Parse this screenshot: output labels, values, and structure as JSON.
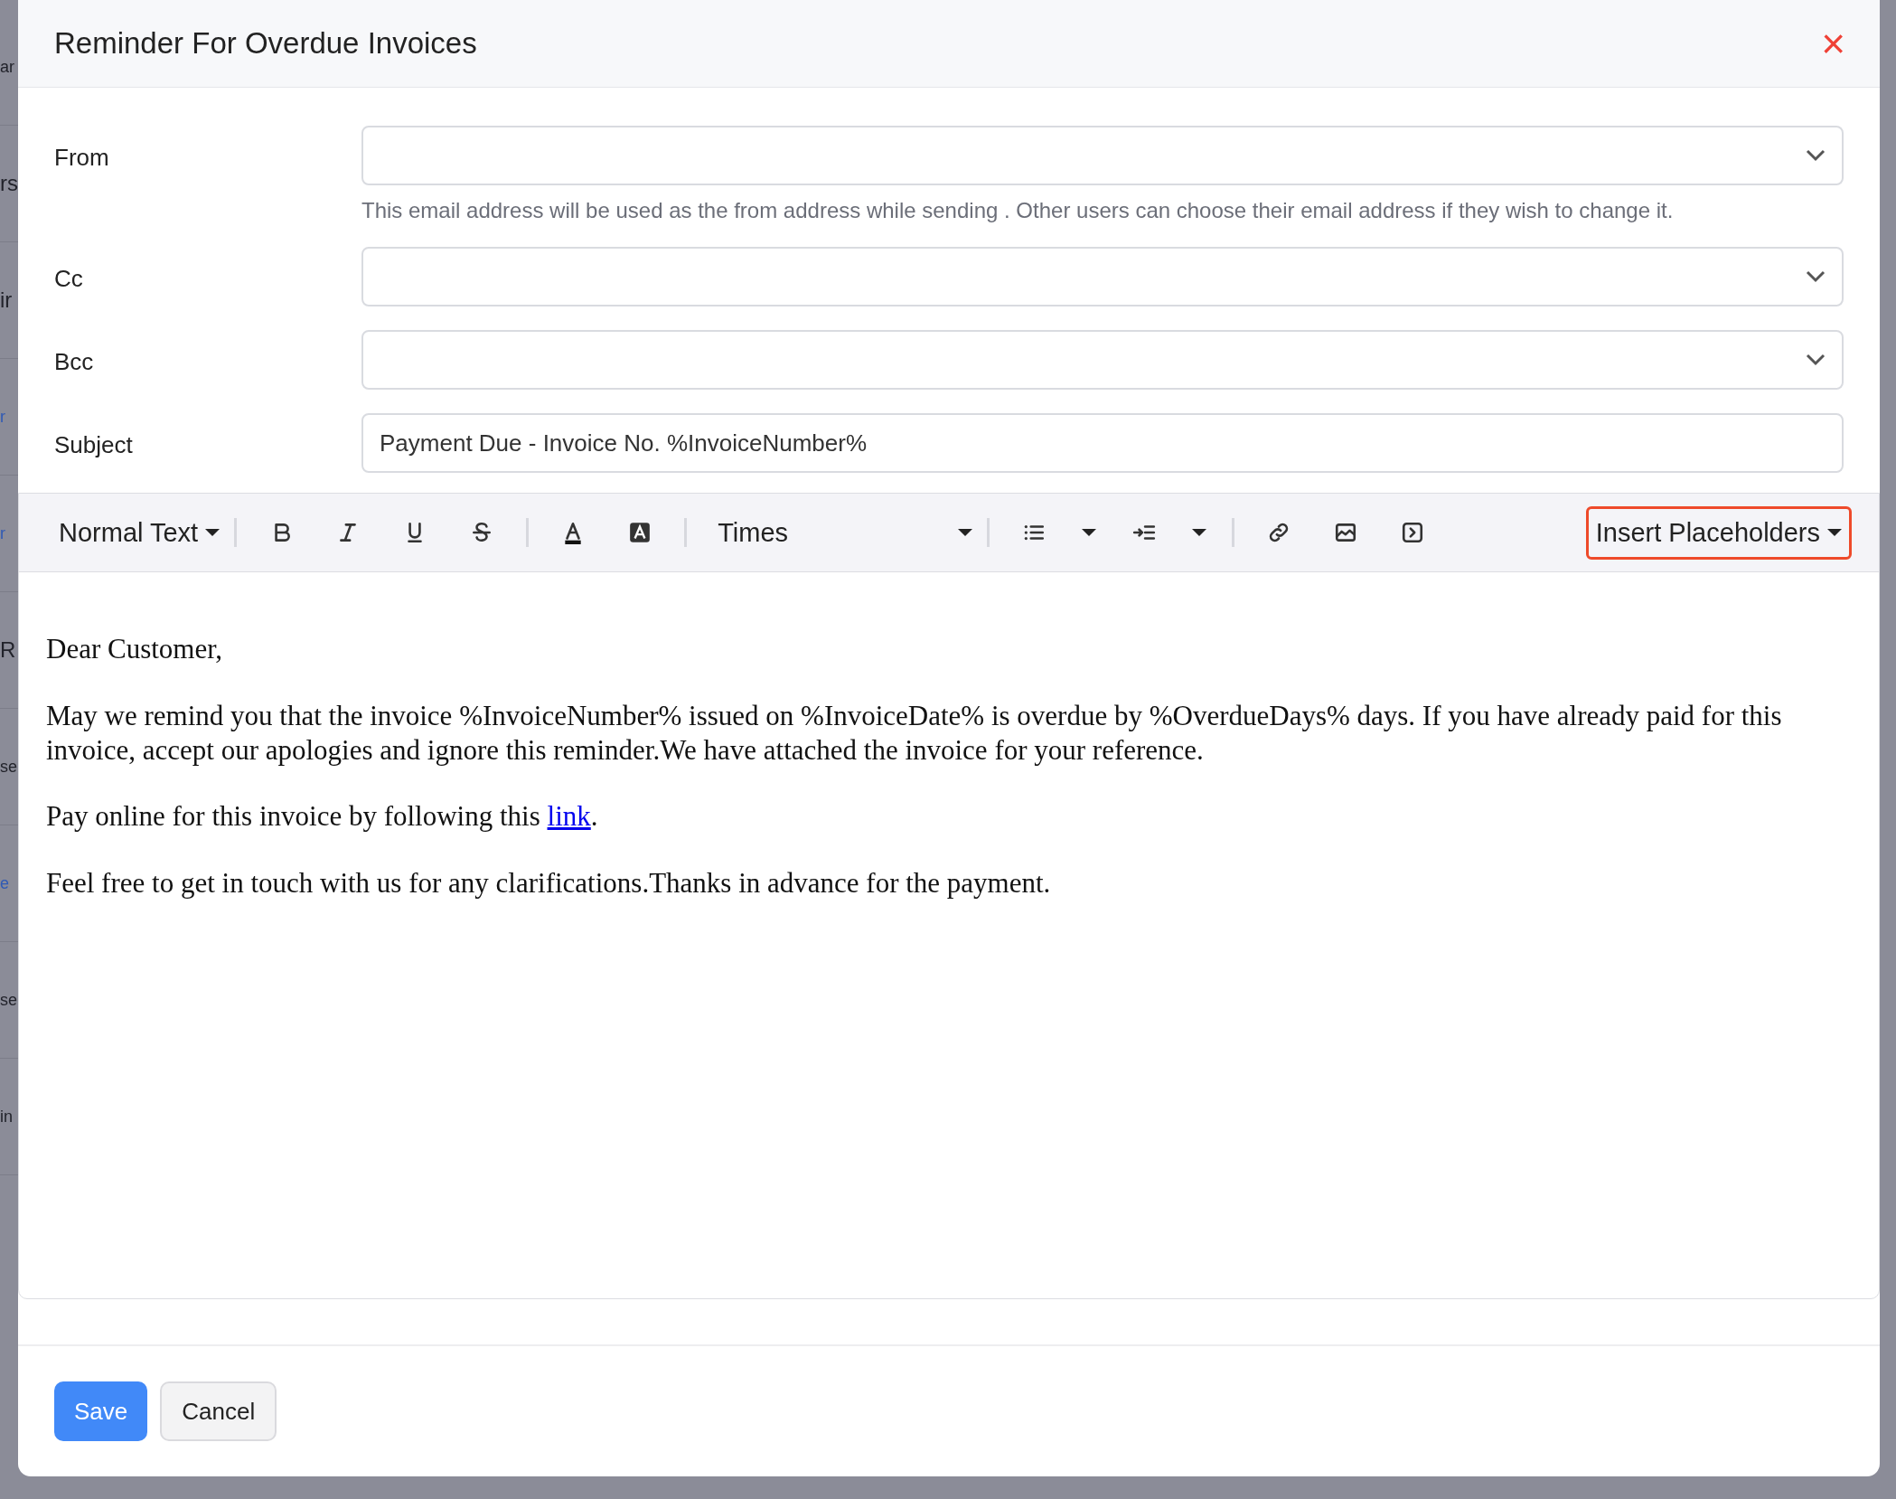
{
  "background_fragments": [
    {
      "text": "ar",
      "kind": "text"
    },
    {
      "text": "rs",
      "kind": "heading"
    },
    {
      "text": "ir",
      "kind": "heading"
    },
    {
      "text": "r",
      "kind": "link"
    },
    {
      "text": "r",
      "kind": "link"
    },
    {
      "text": "R",
      "kind": "heading"
    },
    {
      "text": "se",
      "kind": "text"
    },
    {
      "text": "e",
      "kind": "link"
    },
    {
      "text": "se",
      "kind": "text"
    },
    {
      "text": "in",
      "kind": "text"
    }
  ],
  "dialog": {
    "title": "Reminder For Overdue Invoices",
    "close": "×"
  },
  "fields": [
    {
      "label": "From",
      "kind": "select",
      "hint": "This email address will be used as the from address while sending . Other users can choose their email address if they wish to change it."
    },
    {
      "label": "Cc",
      "kind": "select"
    },
    {
      "label": "Bcc",
      "kind": "select"
    },
    {
      "label": "Subject",
      "kind": "text",
      "value": "Payment Due - Invoice No. %InvoiceNumber%"
    }
  ],
  "toolbar": {
    "format": "Normal Text",
    "font": "Times",
    "placeholders": {
      "label": "Insert Placeholders",
      "focused": true
    }
  },
  "body": [
    {
      "text": "Dear Customer,"
    },
    {
      "text": "May we remind you that the invoice %InvoiceNumber% issued on %InvoiceDate% is overdue by %OverdueDays% days. If you have already paid for this invoice, accept our apologies and ignore this reminder.We have attached the invoice for your reference."
    },
    {
      "text": "Pay online for this invoice by following this ",
      "link": "link",
      "after": "."
    },
    {
      "text": "Feel free to get in touch with us for any clarifications.Thanks in advance for the payment."
    }
  ],
  "buttons": [
    {
      "label": "Save",
      "kind": "primary"
    },
    {
      "label": "Cancel",
      "kind": "secondary"
    }
  ]
}
